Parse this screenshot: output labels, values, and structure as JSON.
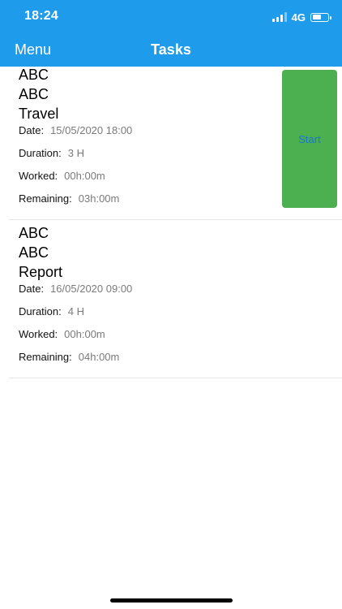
{
  "status_bar": {
    "time": "18:24",
    "network": "4G",
    "signal_icon": "cellular-signal-icon",
    "battery_icon": "battery-icon",
    "battery_level_fraction": 0.6
  },
  "nav": {
    "menu_label": "Menu",
    "title": "Tasks"
  },
  "colors": {
    "header_bg": "#1E9BEA",
    "start_bg": "#4CAF50",
    "start_text": "#1976D2"
  },
  "tasks": [
    {
      "line1": "ABC",
      "line2": "ABC",
      "name": "Travel",
      "date_label": "Date:",
      "date": "15/05/2020 18:00",
      "duration_label": "Duration:",
      "duration": "3 H",
      "worked_label": "Worked:",
      "worked": "00h:00m",
      "remaining_label": "Remaining:",
      "remaining": "03h:00m",
      "action_label": "Start"
    },
    {
      "line1": "ABC",
      "line2": "ABC",
      "name": "Report",
      "date_label": "Date:",
      "date": "16/05/2020 09:00",
      "duration_label": "Duration:",
      "duration": "4 H",
      "worked_label": "Worked:",
      "worked": "00h:00m",
      "remaining_label": "Remaining:",
      "remaining": "04h:00m"
    }
  ]
}
